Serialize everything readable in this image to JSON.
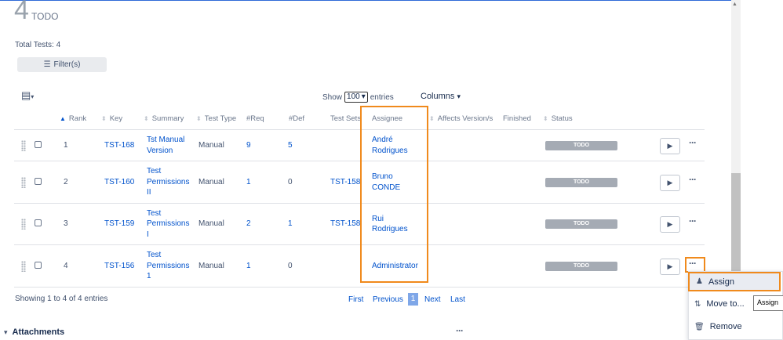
{
  "header": {
    "count": "4",
    "status_label": "TODO",
    "total_tests": "Total Tests: 4",
    "filter_label": "Filter(s)"
  },
  "controls": {
    "show_label": "Show",
    "page_size": "100",
    "entries_label": "entries",
    "columns_label": "Columns"
  },
  "columns": {
    "rank": "Rank",
    "key": "Key",
    "summary": "Summary",
    "test_type": "Test Type",
    "req": "#Req",
    "def": "#Def",
    "test_sets": "Test Sets",
    "assignee": "Assignee",
    "affects": "Affects Version/s",
    "finished": "Finished",
    "status": "Status"
  },
  "rows": [
    {
      "rank": "1",
      "key": "TST-168",
      "summary_lines": [
        "Tst Manual",
        "Version"
      ],
      "test_type": "Manual",
      "req": "9",
      "def": "5",
      "test_sets": "",
      "assignee_lines": [
        "André",
        "Rodrigues"
      ],
      "status": "TODO"
    },
    {
      "rank": "2",
      "key": "TST-160",
      "summary_lines": [
        "Test",
        "Permissions",
        "II"
      ],
      "test_type": "Manual",
      "req": "1",
      "def": "0",
      "test_sets": "TST-158",
      "assignee_lines": [
        "Bruno",
        "CONDE"
      ],
      "status": "TODO"
    },
    {
      "rank": "3",
      "key": "TST-159",
      "summary_lines": [
        "Test",
        "Permissions",
        "I"
      ],
      "test_type": "Manual",
      "req": "2",
      "def": "1",
      "test_sets": "TST-158",
      "assignee_lines": [
        "Rui",
        "Rodrigues"
      ],
      "status": "TODO"
    },
    {
      "rank": "4",
      "key": "TST-156",
      "summary_lines": [
        "Test",
        "Permissions",
        "1"
      ],
      "test_type": "Manual",
      "req": "1",
      "def": "0",
      "test_sets": "",
      "assignee_lines": [
        "Administrator"
      ],
      "status": "TODO"
    }
  ],
  "footer": {
    "showing": "Showing 1 to 4 of 4 entries",
    "first": "First",
    "previous": "Previous",
    "current_page": "1",
    "next": "Next",
    "last": "Last"
  },
  "attachments": {
    "label": "Attachments"
  },
  "row_menu": {
    "assign": "Assign",
    "move_to": "Move to...",
    "remove": "Remove",
    "tooltip": "Assign"
  },
  "icons": [
    "filter-icon",
    "list-settings-icon",
    "chevron-down-icon",
    "sort-icon",
    "drag-handle-icon",
    "play-icon",
    "more-icon",
    "user-icon",
    "move-icon",
    "trash-icon"
  ],
  "colors": {
    "link": "#0052cc",
    "highlight": "#f08a1c",
    "status_bg": "#a5abb4",
    "page_current": "#7fa7e8"
  }
}
